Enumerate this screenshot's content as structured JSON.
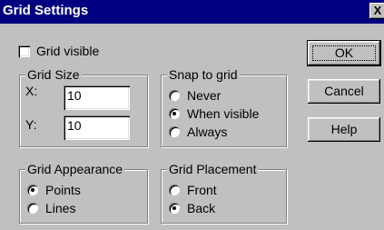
{
  "window": {
    "title": "Grid Settings",
    "close_label": "X"
  },
  "grid_visible": {
    "label": "Grid visible",
    "checked": false
  },
  "grid_size": {
    "title": "Grid Size",
    "x_label": "X:",
    "x_value": "10",
    "y_label": "Y:",
    "y_value": "10"
  },
  "snap_to_grid": {
    "title": "Snap to grid",
    "options": [
      "Never",
      "When visible",
      "Always"
    ],
    "selected": "When visible"
  },
  "grid_appearance": {
    "title": "Grid Appearance",
    "options": [
      "Points",
      "Lines"
    ],
    "selected": "Points"
  },
  "grid_placement": {
    "title": "Grid Placement",
    "options": [
      "Front",
      "Back"
    ],
    "selected": "Back"
  },
  "buttons": {
    "ok": "OK",
    "cancel": "Cancel",
    "help": "Help"
  }
}
